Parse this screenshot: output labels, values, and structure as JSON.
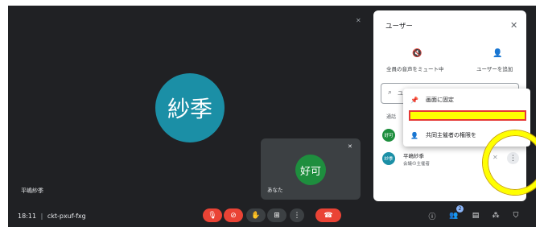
{
  "meeting": {
    "time": "18:11",
    "separator": "|",
    "code": "ckt-pxuf-fxg"
  },
  "main_speaker": {
    "avatar_text": "紗季",
    "name": "平嶋紗季"
  },
  "self_tile": {
    "avatar_text": "好可",
    "label": "あなた"
  },
  "panel": {
    "title": "ユーザー",
    "mute_all_label": "全員の音声をミュート中",
    "add_user_label": "ユーザーを追加",
    "search_placeholder": "ユ",
    "section_label": "通話",
    "users": [
      {
        "avatar_text": "好可"
      },
      {
        "avatar_text": "紗季",
        "name": "平嶋紗季",
        "role": "会議の主催者"
      }
    ]
  },
  "context_menu": {
    "items": [
      {
        "label": "画面に固定"
      },
      {
        "label": ""
      },
      {
        "label": "共同主催者の権限を"
      }
    ]
  },
  "badges": {
    "people_count": "2"
  },
  "colors": {
    "background": "#202124",
    "main_avatar": "#1b8fa6",
    "self_avatar": "#1e8e3e",
    "leave": "#ea4335",
    "annotation": "#ffff00"
  }
}
